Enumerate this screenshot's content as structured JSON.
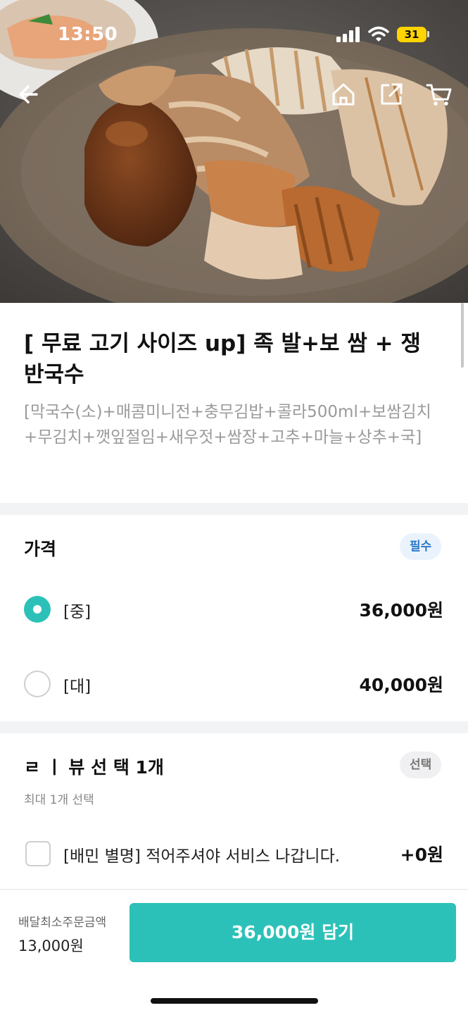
{
  "status_bar": {
    "time": "13:50",
    "battery": "31"
  },
  "product": {
    "title": "[ 무료 고기 사이즈 up] 족 발+보 쌈 + 쟁 반국수",
    "description": "[막국수(소)+매콤미니전+충무김밥+콜라500ml+보쌈김치+무김치+깻잎절임+새우젓+쌈장+고추+마늘+상추+국]"
  },
  "price_section": {
    "title": "가격",
    "badge": "필수",
    "options": [
      {
        "label": "[중]",
        "price": "36,000원",
        "selected": true
      },
      {
        "label": "[대]",
        "price": "40,000원",
        "selected": false
      }
    ]
  },
  "review_section": {
    "title": "ㄹ ㅣ 뷰 선 택 1개",
    "badge": "선택",
    "note": "최대 1개 선택",
    "options": [
      {
        "label": "[배민 별명] 적어주셔야 서비스 나갑니다.",
        "price": "+0원",
        "checked": false
      }
    ]
  },
  "bottom_bar": {
    "min_order_label": "배달최소주문금액",
    "min_order_value": "13,000원",
    "cta_label": "36,000원 담기"
  },
  "icons": [
    "back-arrow-icon",
    "home-icon",
    "share-icon",
    "cart-icon",
    "signal-icon",
    "wifi-icon",
    "battery-icon"
  ],
  "colors": {
    "accent": "#2cc1b8",
    "required_badge": "#2a78c8",
    "battery": "#ffd400"
  }
}
